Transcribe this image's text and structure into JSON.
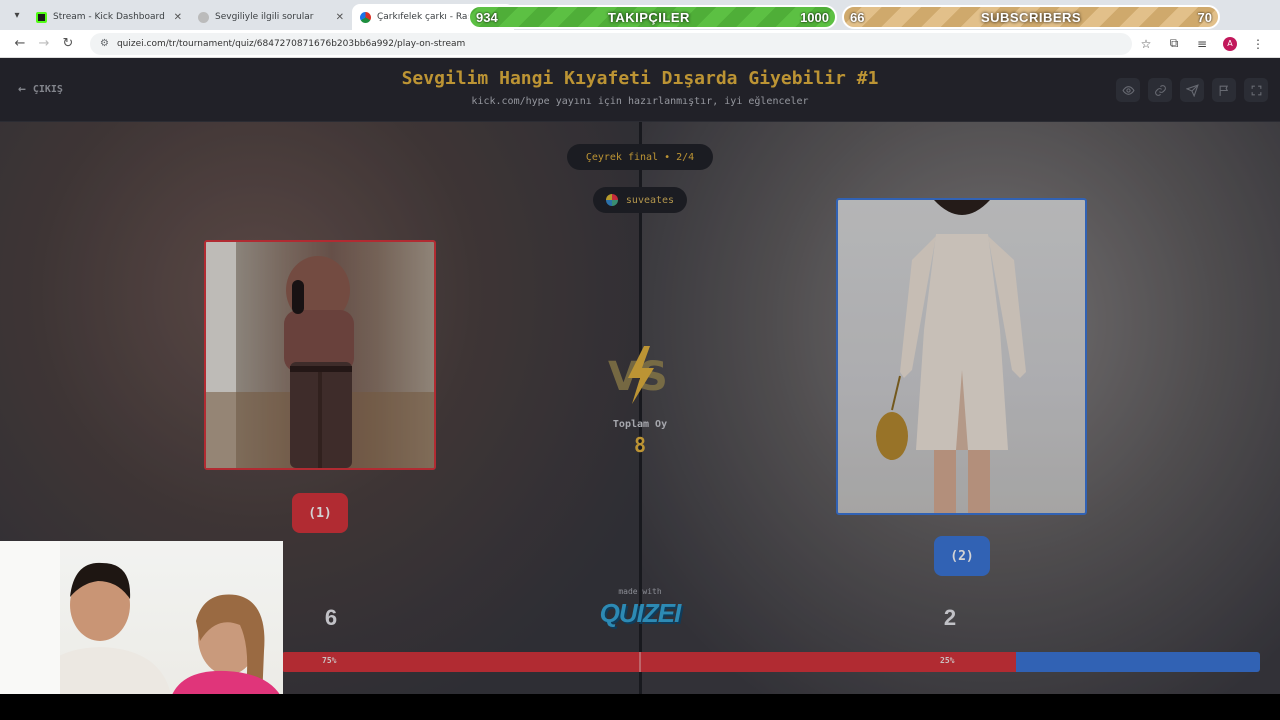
{
  "browser": {
    "tabs": [
      {
        "title": "Stream - Kick Dashboard",
        "favicon_color": "#53fc18",
        "active": false
      },
      {
        "title": "Sevgiliyle ilgili sorular",
        "favicon_color": "#888888",
        "active": false
      },
      {
        "title": "Çarkıfelek çarkı - Rastgele Se",
        "favicon_color": "#d93025",
        "active": true
      }
    ],
    "url": "quizei.com/tr/tournament/quiz/6847270871676b203bb6a992/play-on-stream"
  },
  "overlays": {
    "followers": {
      "current": "934",
      "label": "TAKIPÇILER",
      "goal": "1000",
      "progress": 0.934,
      "color": "#5cc043"
    },
    "subscribers": {
      "current": "66",
      "label": "SUBSCRIBERS",
      "goal": "70",
      "progress": 0.943,
      "color": "#e2c08a"
    }
  },
  "quiz": {
    "exit_label": "ÇIKIŞ",
    "title": "Sevgilim Hangi Kıyafeti Dışarda Giyebilir #1",
    "subtitle": "kick.com/hype yayını için hazırlanmıştır, iyi eğlenceler",
    "round": "Çeyrek final • 2/4",
    "username": "suveates",
    "total_label": "Toplam Oy",
    "total_votes": "8",
    "left": {
      "button": "(1)",
      "votes": "6",
      "percent": "75%",
      "color": "#d6333a"
    },
    "right": {
      "button": "(2)",
      "votes": "2",
      "percent": "25%",
      "color": "#3a76d8"
    },
    "made_with": "made with",
    "logo": "QUIZEI",
    "accent": "#e3b23c"
  }
}
